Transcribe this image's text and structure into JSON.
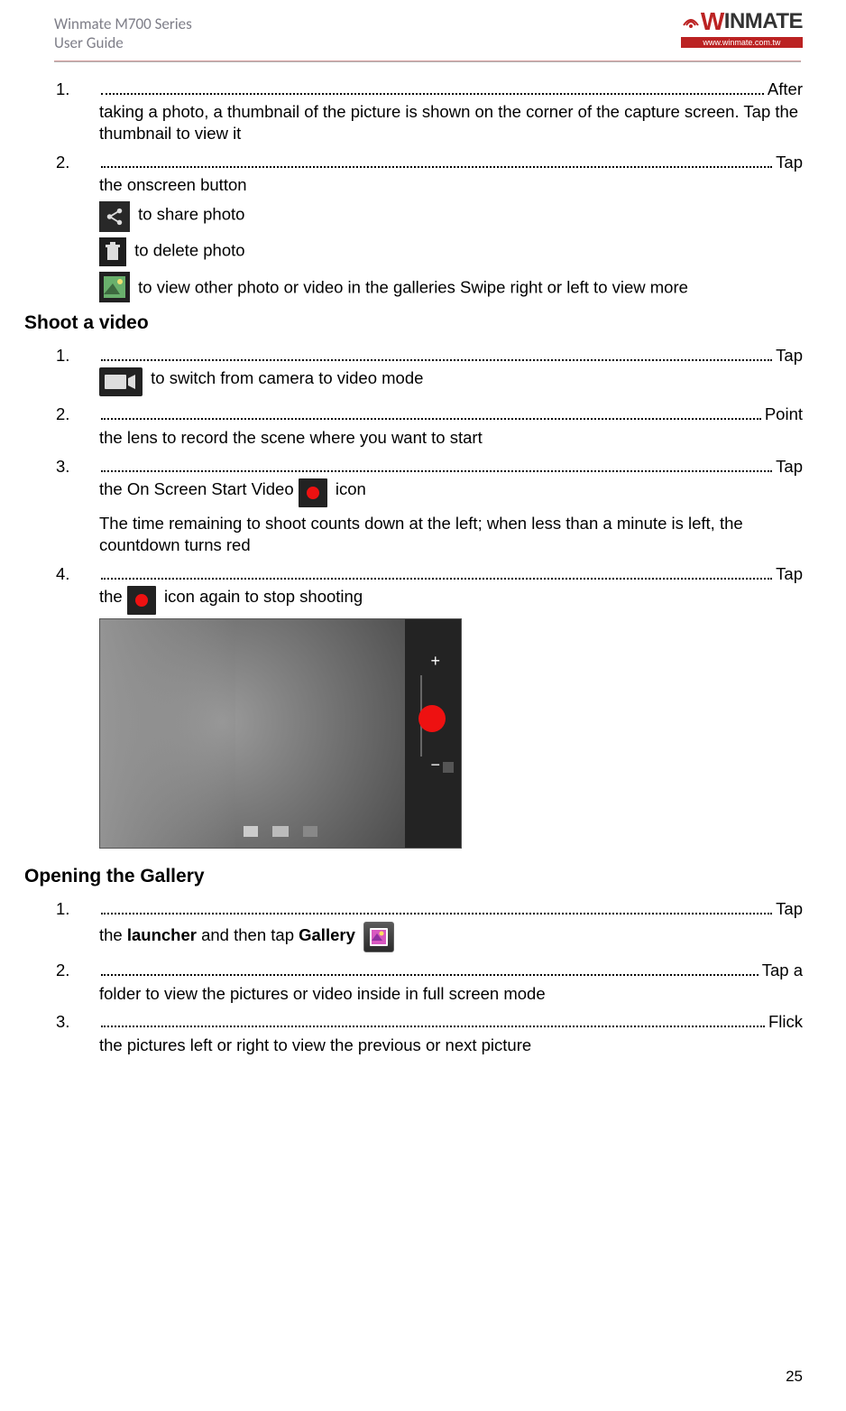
{
  "header": {
    "line1": "Winmate M700 Series",
    "line2": "User Guide",
    "logo_text_w": "W",
    "logo_text_rest": "INMATE",
    "logo_url": "www.winmate.com.tw"
  },
  "sec_photo": {
    "item1_trail": "After",
    "item1_body": "taking a photo, a thumbnail of the picture is shown on the corner of the capture screen. Tap the thumbnail to view it",
    "item2_trail": "Tap",
    "item2_body": "the onscreen button",
    "share_text": " to share photo",
    "delete_text": " to delete photo",
    "view_text": " to view other photo or video in the galleries Swipe right or left to view more"
  },
  "sec_video_title": "Shoot a video",
  "sec_video": {
    "item1_trail": "Tap",
    "item1_body": " to switch from camera to video mode",
    "item2_trail": "Point",
    "item2_body": "the lens to record the scene where you want to start",
    "item3_trail": "Tap",
    "item3_body_a": "the On Screen Start Video ",
    "item3_body_b": " icon",
    "item3_body2": "The time remaining to shoot counts down at the left; when less than a minute is left, the countdown turns red",
    "item4_trail": "Tap",
    "item4_body_a": "the ",
    "item4_body_b": " icon again to stop shooting"
  },
  "sec_gallery_title": "Opening the Gallery",
  "sec_gallery": {
    "item1_trail": "Tap",
    "item1_body_a": "the ",
    "item1_bold1": "launcher",
    "item1_body_b": " and then tap ",
    "item1_bold2": "Gallery",
    "item2_trail": "Tap a",
    "item2_body": "folder to view the pictures or video inside in full screen mode",
    "item3_trail": "Flick",
    "item3_body": "the pictures left or right to view the previous or next picture"
  },
  "nums": {
    "n1": "1.",
    "n2": "2.",
    "n3": "3.",
    "n4": "4."
  },
  "page_number": "25"
}
